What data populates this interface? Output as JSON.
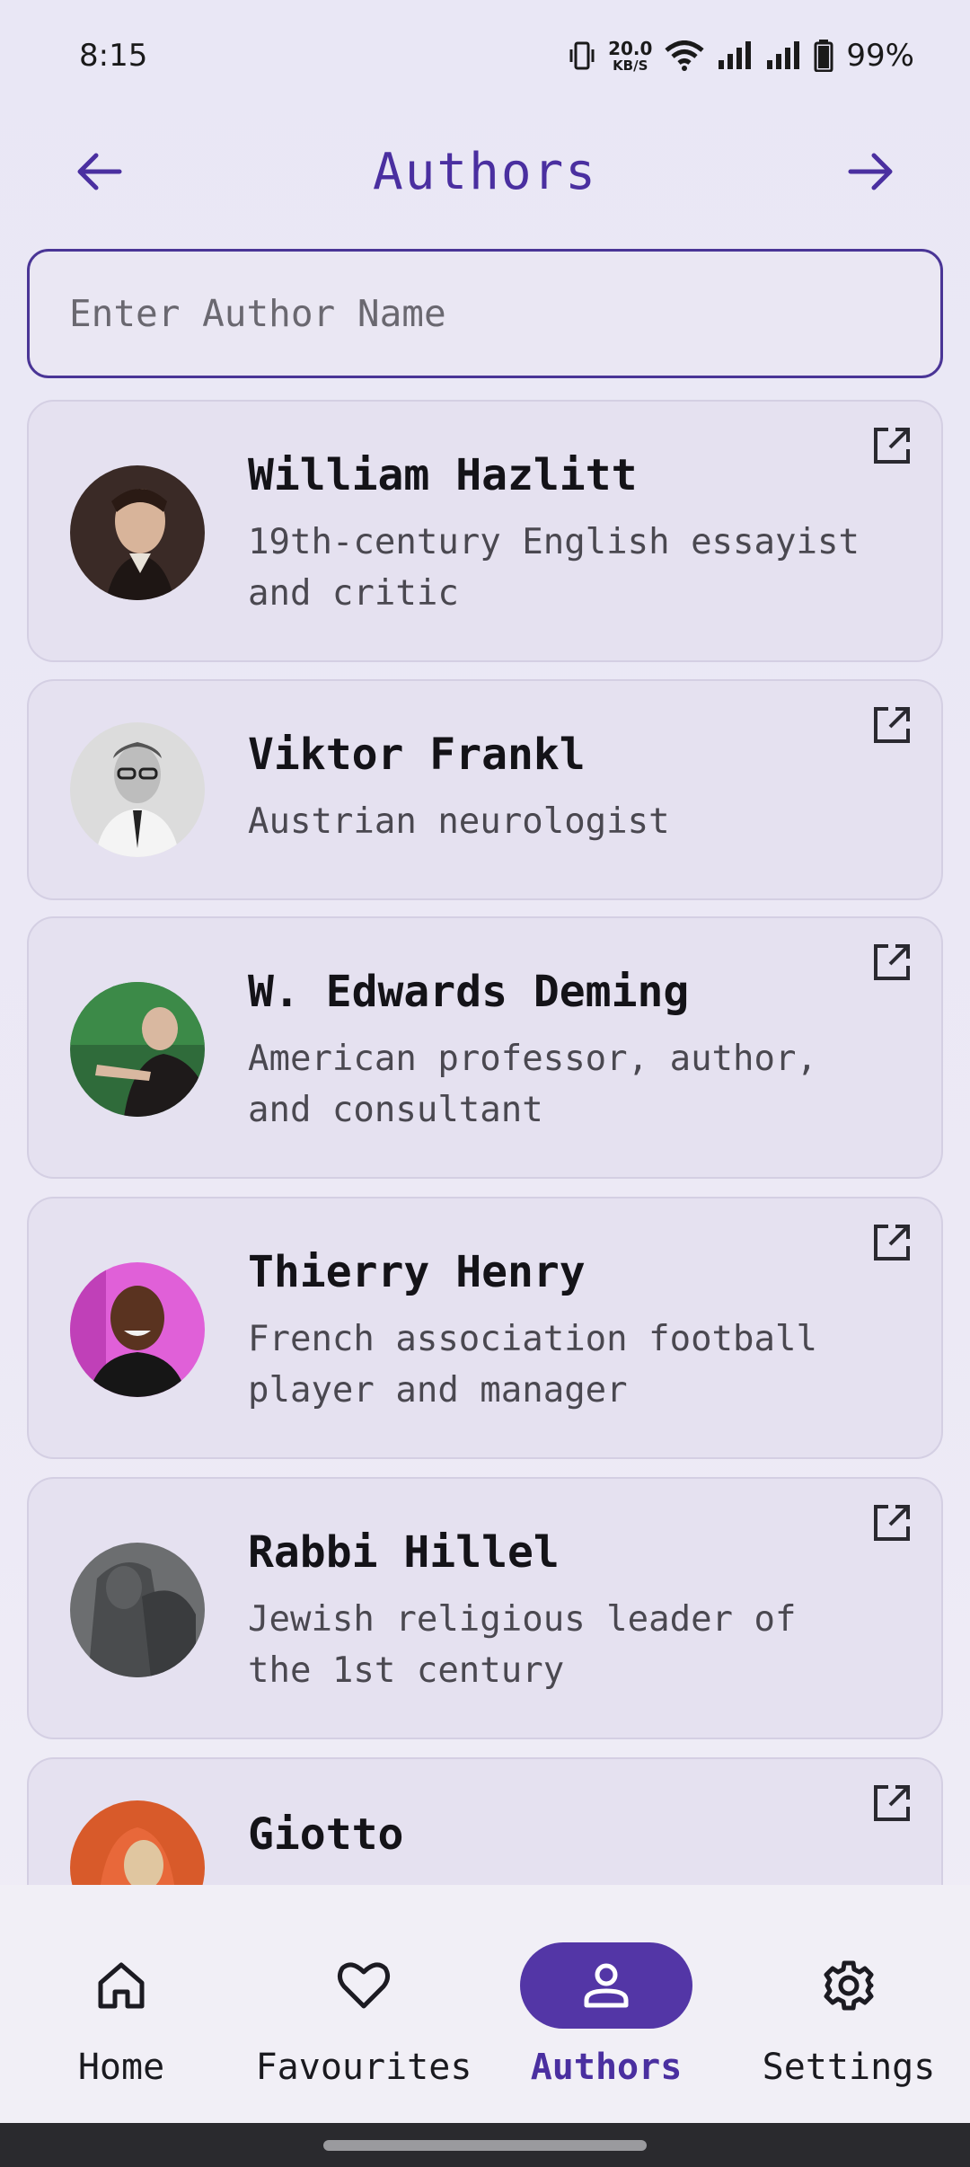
{
  "status": {
    "time": "8:15",
    "netspeed_value": "20.0",
    "netspeed_unit": "KB/S",
    "battery": "99%"
  },
  "header": {
    "title": "Authors"
  },
  "search": {
    "placeholder": "Enter Author Name",
    "value": ""
  },
  "authors": [
    {
      "name": "William Hazlitt",
      "desc_lines": [
        "19th-century English essayist",
        "and critic"
      ]
    },
    {
      "name": "Viktor Frankl",
      "desc_lines": [
        "Austrian neurologist"
      ]
    },
    {
      "name": "W. Edwards Deming",
      "desc_lines": [
        "American professor, author,",
        "and consultant"
      ]
    },
    {
      "name": "Thierry Henry",
      "desc_lines": [
        "French association football",
        "player and manager"
      ]
    },
    {
      "name": "Rabbi Hillel",
      "desc_lines": [
        "Jewish religious leader of",
        "the 1st century"
      ]
    },
    {
      "name": "Giotto",
      "desc_lines": []
    }
  ],
  "bottom_nav": [
    {
      "label": "Home",
      "icon": "home-icon",
      "active": false
    },
    {
      "label": "Favourites",
      "icon": "heart-icon",
      "active": false
    },
    {
      "label": "Authors",
      "icon": "person-icon",
      "active": true
    },
    {
      "label": "Settings",
      "icon": "gear-icon",
      "active": false
    }
  ],
  "colors": {
    "accent": "#4a2fa0",
    "active_pill": "#5336a6",
    "card_bg": "#e5e1f0"
  }
}
